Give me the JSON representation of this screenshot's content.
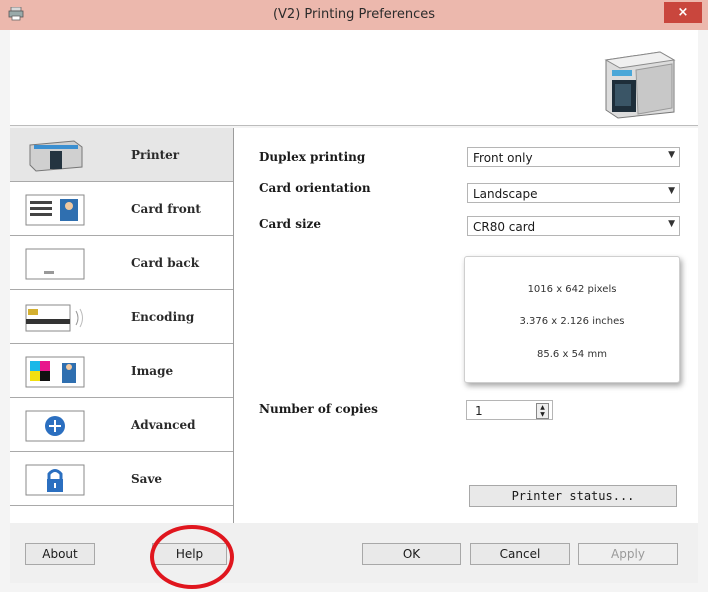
{
  "window": {
    "title": "(V2) Printing Preferences",
    "close_label": "×"
  },
  "sidebar": {
    "items": [
      {
        "label": "Printer",
        "icon": "printer-icon"
      },
      {
        "label": "Card front",
        "icon": "card-front-icon"
      },
      {
        "label": "Card back",
        "icon": "card-back-icon"
      },
      {
        "label": "Encoding",
        "icon": "encoding-icon"
      },
      {
        "label": "Image",
        "icon": "image-icon"
      },
      {
        "label": "Advanced",
        "icon": "advanced-icon"
      },
      {
        "label": "Save",
        "icon": "lock-icon"
      }
    ],
    "active_index": 0
  },
  "printer_panel": {
    "duplex": {
      "label": "Duplex printing",
      "value": "Front only"
    },
    "orientation": {
      "label": "Card orientation",
      "value": "Landscape"
    },
    "card_size": {
      "label": "Card size",
      "value": "CR80 card"
    },
    "preview": {
      "pixels": "1016 x 642 pixels",
      "inches": "3.376 x 2.126 inches",
      "mm": "85.6 x 54 mm"
    },
    "copies": {
      "label": "Number of copies",
      "value": "1"
    },
    "status_button": "Printer status..."
  },
  "buttons": {
    "about": "About",
    "help": "Help",
    "ok": "OK",
    "cancel": "Cancel",
    "apply": "Apply"
  },
  "colors": {
    "titlebar": "#ecb8ad",
    "close": "#c9463d",
    "highlight": "#e0161e"
  }
}
